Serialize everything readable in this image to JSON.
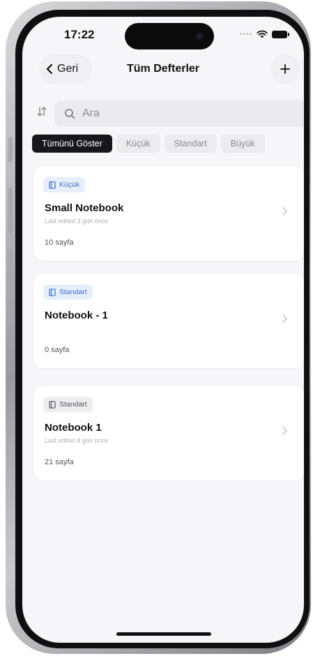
{
  "status_bar": {
    "time": "17:22",
    "signal_icon": "signal-dots-icon",
    "wifi_icon": "wifi-icon",
    "battery_icon": "battery-icon"
  },
  "nav": {
    "back_label": "Geri",
    "title": "Tüm Defterler",
    "back_icon": "chevron-left-icon",
    "add_icon": "plus-icon"
  },
  "search": {
    "placeholder": "Ara",
    "value": "",
    "sort_icon": "sort-arrows-icon",
    "search_icon": "search-icon"
  },
  "filters": [
    {
      "label": "Tümünü Göster",
      "active": true
    },
    {
      "label": "Küçük",
      "active": false
    },
    {
      "label": "Standart",
      "active": false
    },
    {
      "label": "Büyük",
      "active": false
    }
  ],
  "notebooks": [
    {
      "badge": "Küçük",
      "badge_color": "#3b6fd0",
      "title": "Small Notebook",
      "subtitle": "Last edited 3 gün önce",
      "pages": "10 sayfa"
    },
    {
      "badge": "Standart",
      "badge_color": "#3b6fd0",
      "title": "Notebook - 1",
      "subtitle": "",
      "pages": "0 sayfa"
    },
    {
      "badge": "Standart",
      "badge_color": "#55555a",
      "title": "Notebook 1",
      "subtitle": "Last edited 8 gün önce",
      "pages": "21 sayfa"
    }
  ],
  "colors": {
    "accent": "#3b6fd0",
    "active_chip": "#17171a",
    "background": "#f6f6f8"
  }
}
